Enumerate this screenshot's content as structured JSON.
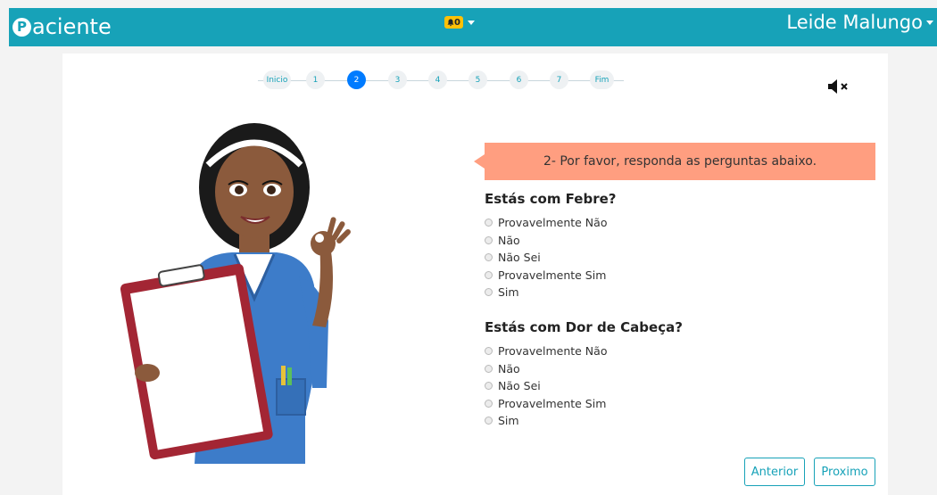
{
  "navbar": {
    "brand_letter": "P",
    "brand_text": "aciente",
    "notification_count": "0",
    "user_name": "Leide Malungo"
  },
  "stepper": {
    "steps": [
      {
        "label": "Inicio",
        "active": false
      },
      {
        "label": "1",
        "active": false
      },
      {
        "label": "2",
        "active": true
      },
      {
        "label": "3",
        "active": false
      },
      {
        "label": "4",
        "active": false
      },
      {
        "label": "5",
        "active": false
      },
      {
        "label": "6",
        "active": false
      },
      {
        "label": "7",
        "active": false
      },
      {
        "label": "Fim",
        "active": false
      }
    ]
  },
  "audio": {
    "icon": "volume-mute-icon"
  },
  "banner": {
    "text": "2- Por favor, responda as perguntas abaixo.",
    "color": "#ff9e80"
  },
  "questions": [
    {
      "title": "Estás com Febre?",
      "options": [
        "Provavelmente Não",
        "Não",
        "Não Sei",
        "Provavelmente Sim",
        "Sim"
      ]
    },
    {
      "title": "Estás com Dor de Cabeça?",
      "options": [
        "Provavelmente Não",
        "Não",
        "Não Sei",
        "Provavelmente Sim",
        "Sim"
      ]
    }
  ],
  "buttons": {
    "previous": "Anterior",
    "next": "Proximo"
  },
  "colors": {
    "primary": "#17a2b8",
    "active_step": "#007bff",
    "badge": "#ffc107"
  }
}
